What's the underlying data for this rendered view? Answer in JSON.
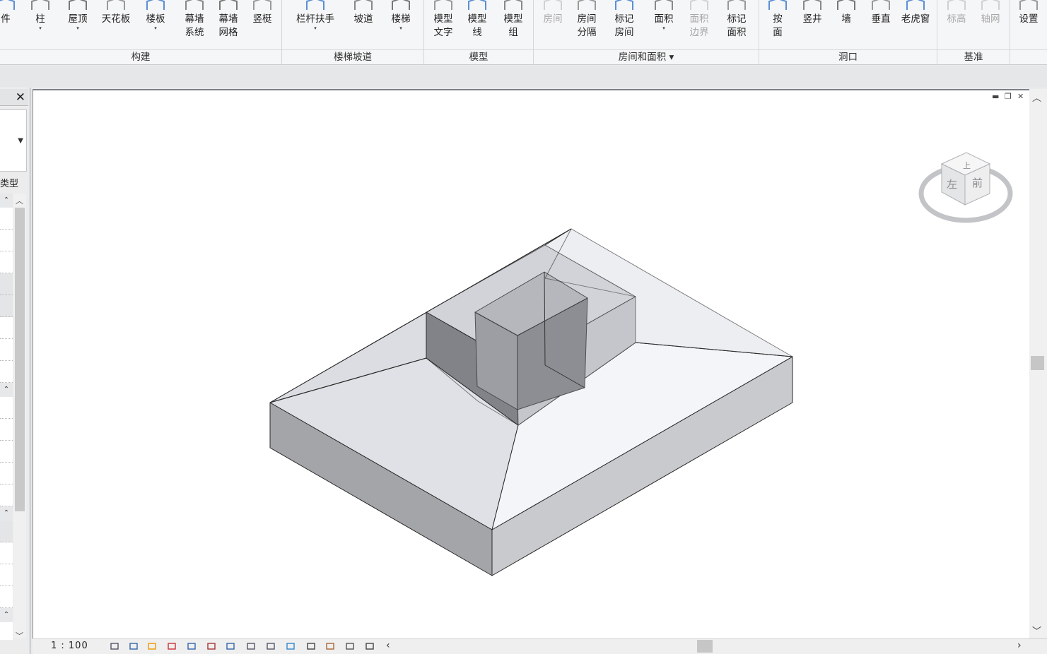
{
  "ribbon": {
    "buttons": [
      {
        "label": "件",
        "dd": "",
        "disabled": false
      },
      {
        "label": "柱",
        "dd": "▾",
        "disabled": false
      },
      {
        "label": "屋顶",
        "dd": "▾",
        "disabled": false
      },
      {
        "label": "天花板",
        "dd": "",
        "disabled": false
      },
      {
        "label": "楼板",
        "dd": "▾",
        "disabled": false
      },
      {
        "label": "幕墙\n系统",
        "dd": "",
        "disabled": false
      },
      {
        "label": "幕墙\n网格",
        "dd": "",
        "disabled": false
      },
      {
        "label": "竖梃",
        "dd": "",
        "disabled": false
      },
      {
        "label": "栏杆扶手",
        "dd": "▾",
        "disabled": false
      },
      {
        "label": "坡道",
        "dd": "",
        "disabled": false
      },
      {
        "label": "楼梯",
        "dd": "▾",
        "disabled": false
      },
      {
        "label": "模型\n文字",
        "dd": "",
        "disabled": false
      },
      {
        "label": "模型\n线",
        "dd": "",
        "disabled": false
      },
      {
        "label": "模型\n组",
        "dd": "",
        "disabled": false
      },
      {
        "label": "房间",
        "dd": "",
        "disabled": true
      },
      {
        "label": "房间\n分隔",
        "dd": "",
        "disabled": false
      },
      {
        "label": "标记\n房间",
        "dd": "",
        "disabled": false
      },
      {
        "label": "面积",
        "dd": "▾",
        "disabled": false
      },
      {
        "label": "面积\n边界",
        "dd": "",
        "disabled": true
      },
      {
        "label": "标记\n面积",
        "dd": "",
        "disabled": false
      },
      {
        "label": "按\n面",
        "dd": "",
        "disabled": false
      },
      {
        "label": "竖井",
        "dd": "",
        "disabled": false
      },
      {
        "label": "墙",
        "dd": "",
        "disabled": false
      },
      {
        "label": "垂直",
        "dd": "",
        "disabled": false
      },
      {
        "label": "老虎窗",
        "dd": "",
        "disabled": false
      },
      {
        "label": "标高",
        "dd": "",
        "disabled": true
      },
      {
        "label": "轴网",
        "dd": "",
        "disabled": true
      },
      {
        "label": "设置",
        "dd": "",
        "disabled": false
      }
    ],
    "panels": [
      {
        "label": "构建"
      },
      {
        "label": "楼梯坡道"
      },
      {
        "label": "模型"
      },
      {
        "label": "房间和面积 ▾"
      },
      {
        "label": "洞口"
      },
      {
        "label": "基准"
      }
    ]
  },
  "properties": {
    "close": "✕",
    "type_label": "类型"
  },
  "viewcube": {
    "top": "上",
    "left": "左",
    "front": "前"
  },
  "status": {
    "scale": "1 : 100"
  },
  "colors": {
    "model_fill": "#d9dbe2",
    "viewport_bg": "#ffffff"
  }
}
